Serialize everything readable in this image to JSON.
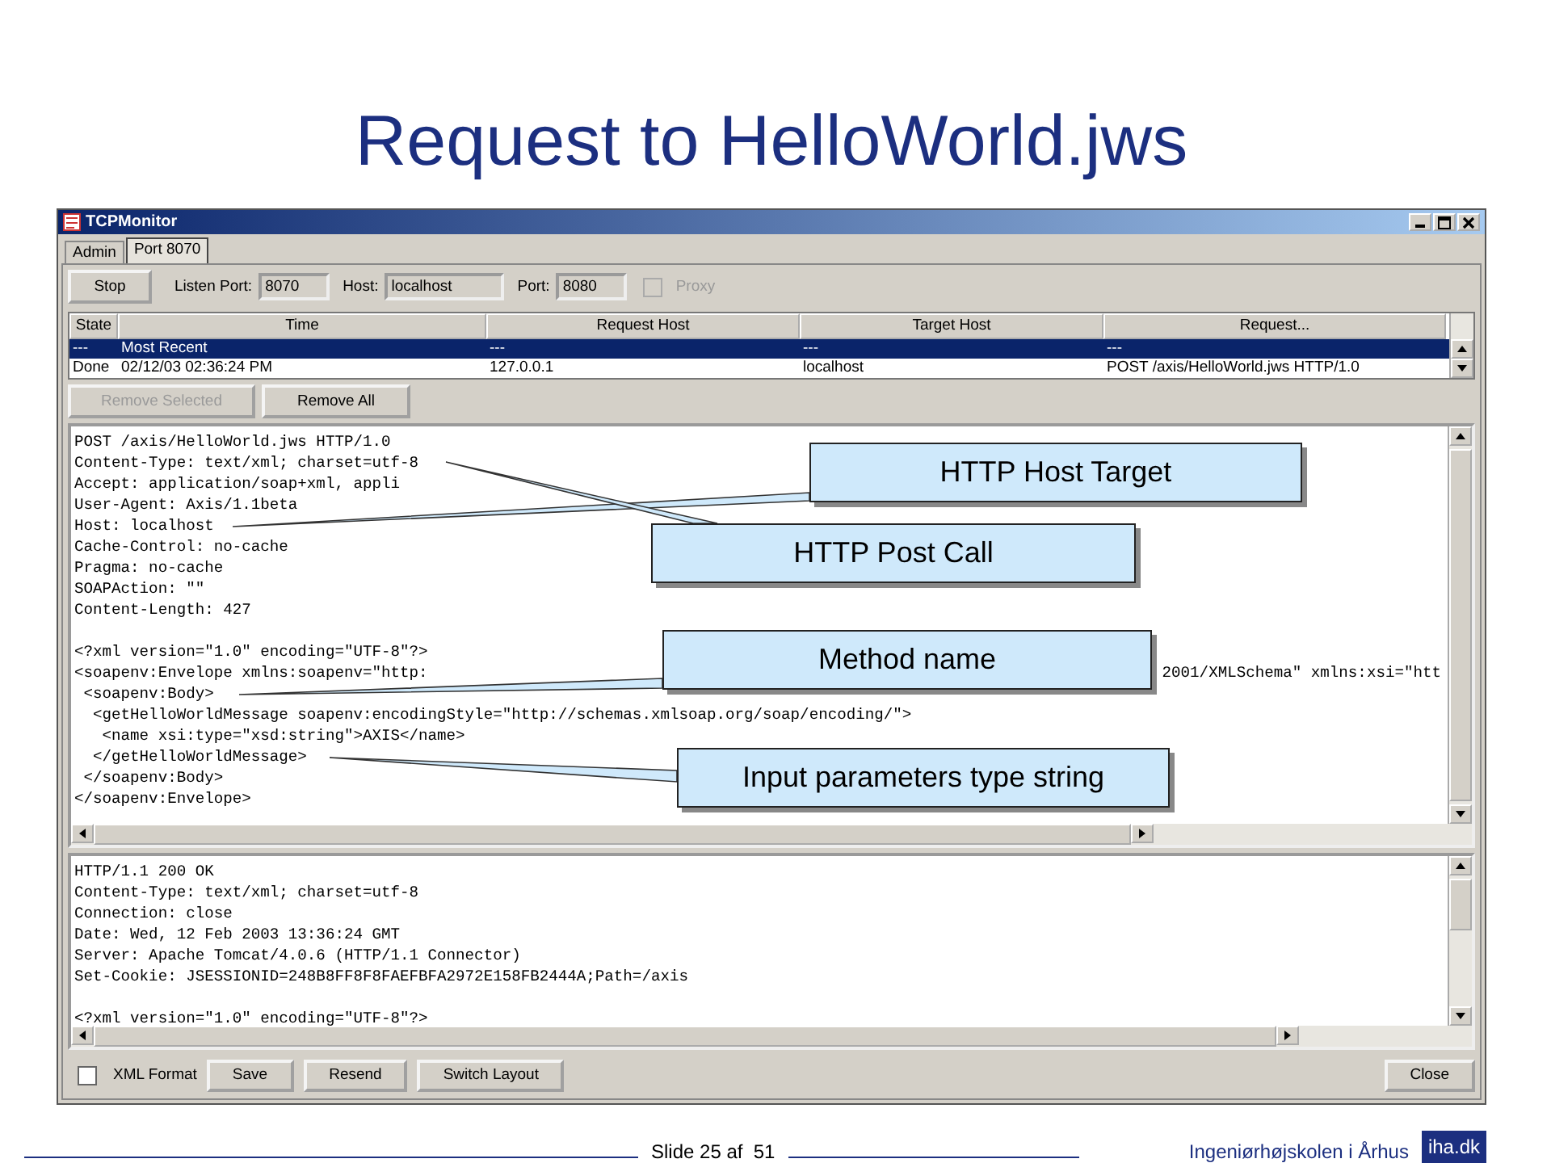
{
  "slide": {
    "title": "Request to HelloWorld.jws"
  },
  "window": {
    "title": "TCPMonitor",
    "tabs": [
      {
        "label": "Admin",
        "selected": false
      },
      {
        "label": "Port 8070",
        "selected": true
      }
    ],
    "stop_button": "Stop",
    "fields": [
      {
        "label": "Listen Port:",
        "value": "8070"
      },
      {
        "label": "Host:",
        "value": "localhost"
      },
      {
        "label": "Port:",
        "value": "8080"
      }
    ],
    "proxy": {
      "label": "Proxy",
      "checked": false,
      "disabled": true
    },
    "table": {
      "columns": [
        "State",
        "Time",
        "Request Host",
        "Target Host",
        "Request..."
      ],
      "rows": [
        {
          "cells": [
            "---",
            "Most Recent",
            "---",
            "---",
            "---"
          ],
          "selected": true
        },
        {
          "cells": [
            "Done",
            "02/12/03 02:36:24 PM",
            "127.0.0.1",
            "localhost",
            "POST /axis/HelloWorld.jws HTTP/1.0"
          ],
          "selected": false
        }
      ]
    },
    "remove_selected": {
      "label": "Remove Selected",
      "disabled": true
    },
    "remove_all": "Remove All",
    "request_headers": [
      "POST /axis/HelloWorld.jws HTTP/1.0",
      "Content-Type: text/xml; charset=utf-8",
      "Accept: application/soap+xml, appli",
      "User-Agent: Axis/1.1beta",
      "Host: localhost",
      "Cache-Control: no-cache",
      "Pragma: no-cache",
      "SOAPAction: \"\"",
      "Content-Length: 427"
    ],
    "request_body": [
      "<?xml version=\"1.0\" encoding=\"UTF-8\"?>",
      {
        "text": "<soapenv:Envelope xmlns:soapenv=\"http:",
        "tail": "2001/XMLSchema\" xmlns:xsi=\"htt"
      },
      " <soapenv:Body>",
      "  <getHelloWorldMessage soapenv:encodingStyle=\"http://schemas.xmlsoap.org/soap/encoding/\">",
      "   <name xsi:type=\"xsd:string\">AXIS</name>",
      "  </getHelloWorldMessage>",
      " </soapenv:Body>",
      "</soapenv:Envelope>"
    ],
    "callouts": [
      {
        "text": "HTTP Host Target"
      },
      {
        "text": "HTTP Post Call"
      },
      {
        "text": "Method name"
      },
      {
        "text": "Input parameters type string"
      }
    ],
    "response_headers": [
      "HTTP/1.1 200 OK",
      "Content-Type: text/xml; charset=utf-8",
      "Connection: close",
      "Date: Wed, 12 Feb 2003 13:36:24 GMT",
      "Server: Apache Tomcat/4.0.6 (HTTP/1.1 Connector)",
      "Set-Cookie: JSESSIONID=248B8FF8F8FAEFBFA2972E158FB2444A;Path=/axis"
    ],
    "response_body": [
      "<?xml version=\"1.0\" encoding=\"UTF-8\"?>"
    ],
    "xml_format": {
      "label": "XML Format",
      "checked": false
    },
    "buttons": [
      "Save",
      "Resend",
      "Switch Layout"
    ],
    "close": "Close"
  },
  "footer": {
    "slide_number": "Slide 25 af  51",
    "institution": "Ingeniørhøjskolen i Århus",
    "logo": "iha.dk"
  }
}
